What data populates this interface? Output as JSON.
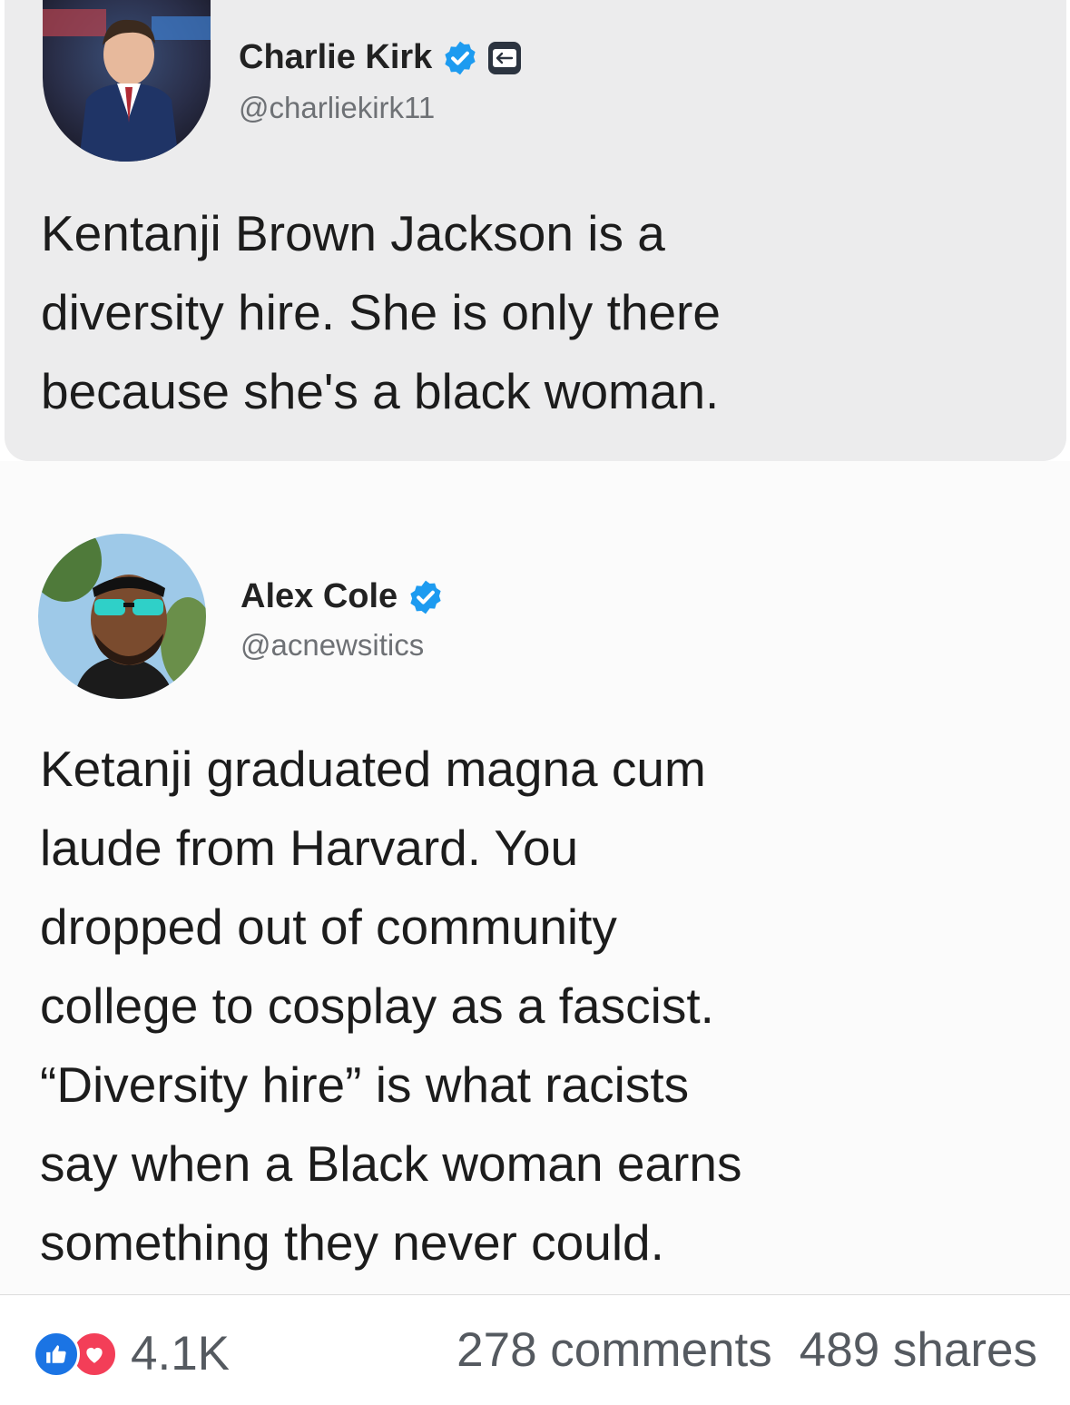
{
  "tweets": [
    {
      "display_name": "Charlie Kirk",
      "handle": "@charliekirk11",
      "verified": true,
      "affiliate_badge_icon": "organization-badge-icon",
      "lines": [
        "Kentanji Brown Jackson is a",
        "diversity hire. She is only there",
        "because she's a black woman."
      ]
    },
    {
      "display_name": "Alex Cole",
      "handle": "@acnewsitics",
      "verified": true,
      "lines": [
        "Ketanji graduated magna cum",
        "laude from Harvard. You",
        "dropped out of community",
        "college to cosplay as a fascist.",
        "“Diversity hire” is what racists",
        "say when a Black woman earns",
        "something they never could."
      ]
    }
  ],
  "footer": {
    "reaction_icons": [
      "like-icon",
      "love-icon"
    ],
    "reaction_count": "4.1K",
    "comments": "278 comments",
    "shares": "489 shares"
  },
  "colors": {
    "verified_blue": "#1d9bf0",
    "like_blue": "#1b74e4",
    "love_red": "#f33e58",
    "card_grey": "#ececed",
    "stats_grey": "#555a60"
  }
}
